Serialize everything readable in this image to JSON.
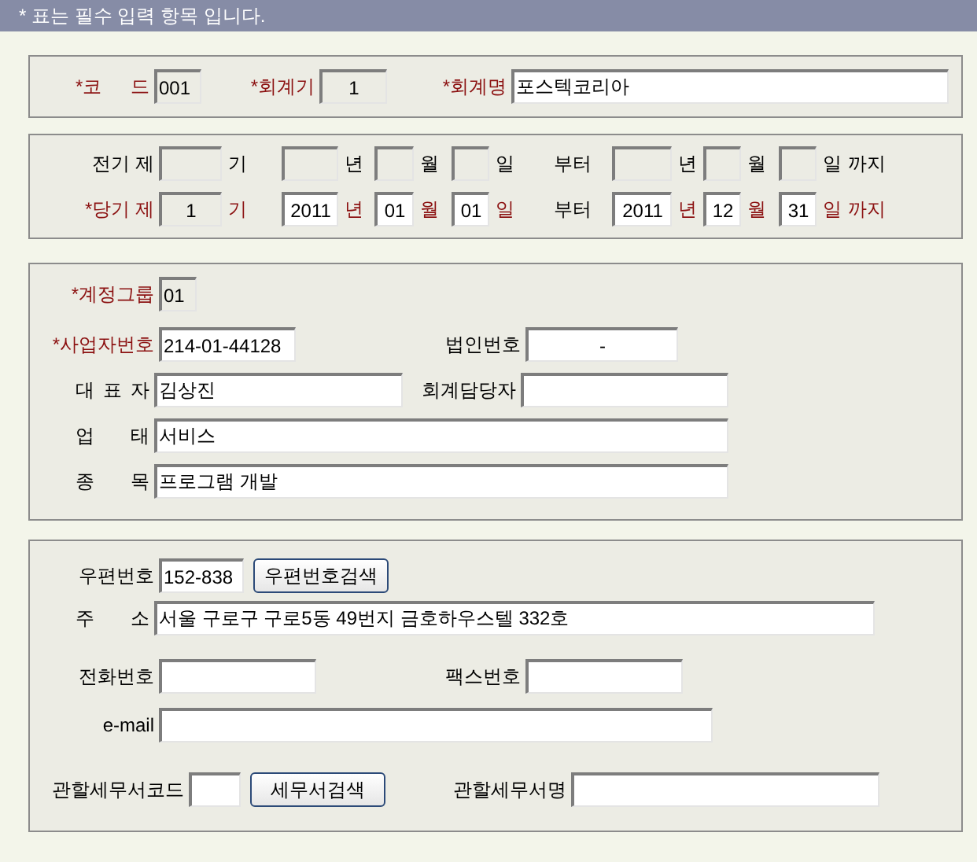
{
  "notice": "* 표는 필수 입력 항목 입니다.",
  "basic": {
    "code": {
      "label": "*코 드",
      "required": true,
      "value": "001",
      "readonly": true
    },
    "term": {
      "label": "*회계기",
      "required": true,
      "value": "1",
      "readonly": true
    },
    "name": {
      "label": "*회계명",
      "required": true,
      "value": "포스텍코리아",
      "readonly": false
    }
  },
  "periods": [
    {
      "label": "전기 제",
      "required": false,
      "term": {
        "readonly": true
      },
      "term_unit": "기",
      "from": [
        {
          "readonly": true,
          "unit": "년"
        },
        {
          "readonly": true,
          "unit": "월"
        },
        {
          "readonly": true,
          "unit": "일"
        }
      ],
      "from_word": "부터",
      "to": [
        {
          "readonly": true,
          "unit": "년"
        },
        {
          "readonly": true,
          "unit": "월"
        },
        {
          "readonly": true,
          "unit": "일"
        }
      ],
      "to_word": "까지"
    },
    {
      "label": "*당기 제",
      "required": true,
      "term": {
        "value": "1",
        "readonly": true
      },
      "term_unit": "기",
      "from": [
        {
          "value": "2011",
          "readonly": false,
          "unit": "년"
        },
        {
          "value": "01",
          "readonly": false,
          "unit": "월"
        },
        {
          "value": "01",
          "readonly": false,
          "unit": "일"
        }
      ],
      "from_word": "부터",
      "to": [
        {
          "value": "2011",
          "readonly": false,
          "unit": "년"
        },
        {
          "value": "12",
          "readonly": false,
          "unit": "월"
        },
        {
          "value": "31",
          "readonly": false,
          "unit": "일"
        }
      ],
      "to_word": "까지"
    }
  ],
  "company": {
    "group": {
      "label": "*계정그룹",
      "required": true,
      "value": "01",
      "readonly": true
    },
    "business_no": {
      "label": "*사업자번호",
      "required": true,
      "value": "214-01-44128",
      "readonly": false
    },
    "corp_no": {
      "label": "법인번호",
      "required": false,
      "value": "-",
      "readonly": false
    },
    "ceo": {
      "label": "대 표 자",
      "required": false,
      "value": "김상진",
      "readonly": false
    },
    "accountant": {
      "label": "회계담당자",
      "required": false,
      "readonly": false
    },
    "business_type": {
      "label": "업 태",
      "required": false,
      "value": "서비스",
      "readonly": false
    },
    "business_item": {
      "label": "종 목",
      "required": false,
      "value": "프로그램 개발",
      "readonly": false
    }
  },
  "address": {
    "zip": {
      "label": "우편번호",
      "required": false,
      "value": "152-838",
      "readonly": false
    },
    "zip_button": "우편번호검색",
    "address": {
      "label": "주 소",
      "required": false,
      "value": "서울 구로구 구로5동 49번지 금호하우스텔 332호",
      "readonly": false
    },
    "phone": {
      "label": "전화번호",
      "required": false,
      "readonly": false
    },
    "fax": {
      "label": "팩스번호",
      "required": false,
      "readonly": false
    },
    "email": {
      "label": "e-mail",
      "required": false,
      "readonly": false
    },
    "tax_office_code": {
      "label": "관할세무서코드",
      "required": false,
      "readonly": false
    },
    "tax_office_button": "세무서검색",
    "tax_office_name": {
      "label": "관할세무서명",
      "required": false,
      "readonly": false
    }
  }
}
